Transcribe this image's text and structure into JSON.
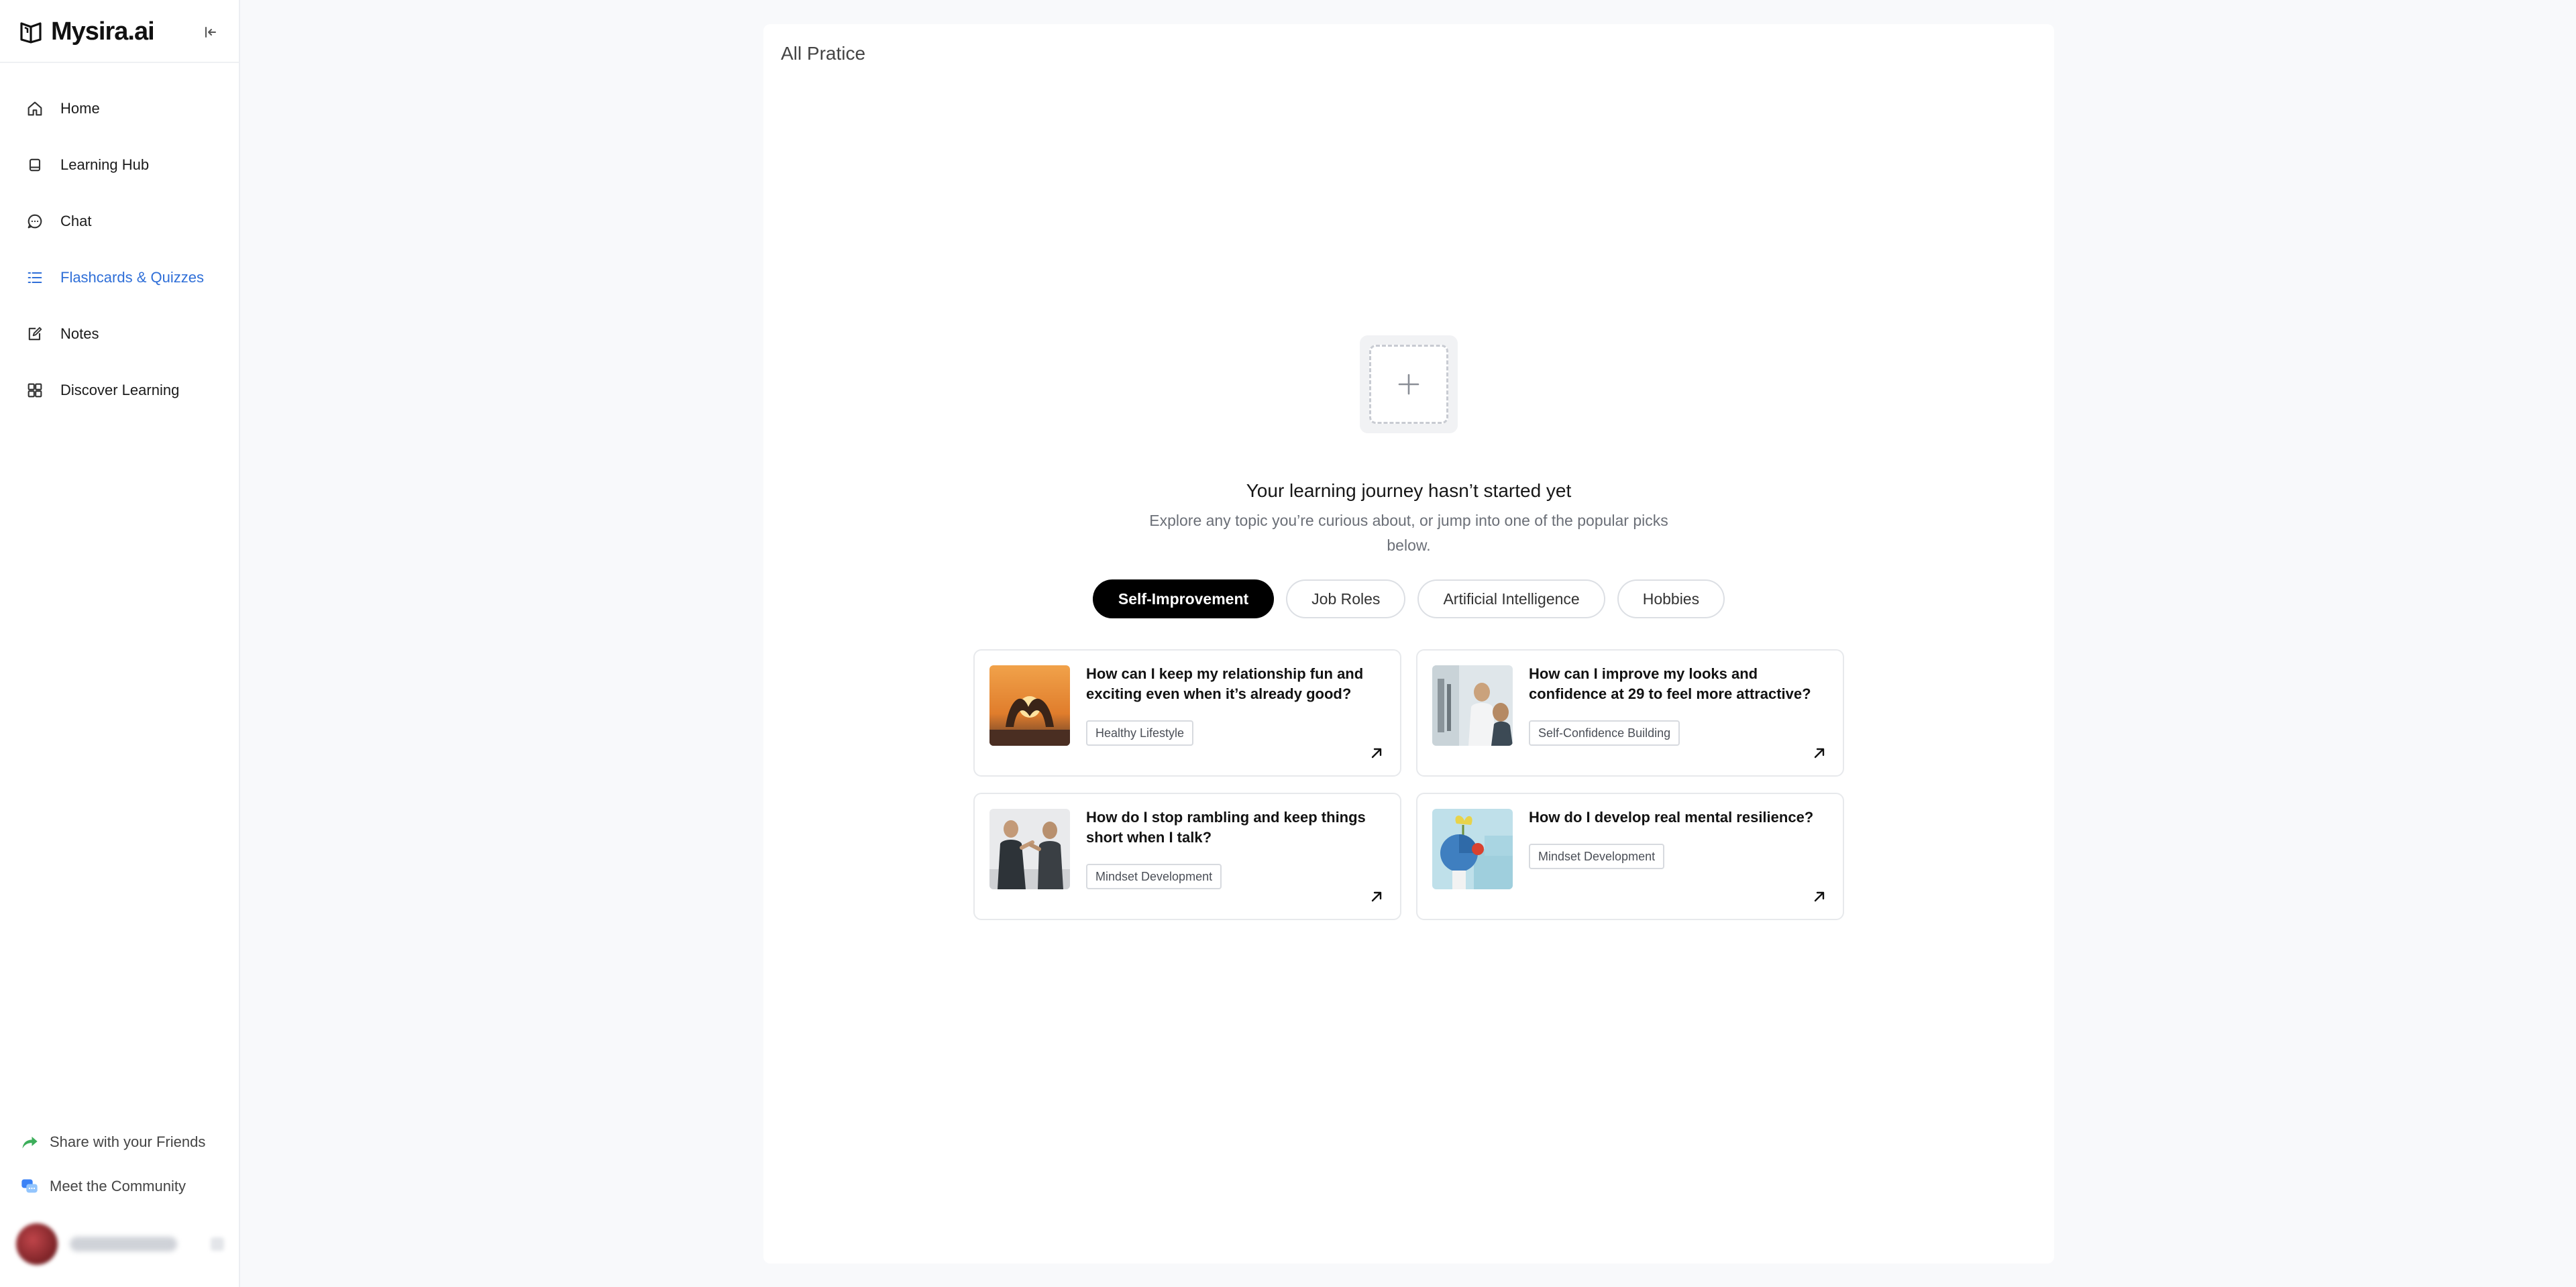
{
  "brand": {
    "name": "Mysira.ai"
  },
  "sidebar": {
    "items": [
      {
        "label": "Home",
        "icon": "home-icon"
      },
      {
        "label": "Learning Hub",
        "icon": "book-icon"
      },
      {
        "label": "Chat",
        "icon": "chat-icon"
      },
      {
        "label": "Flashcards & Quizzes",
        "icon": "list-icon",
        "active": true
      },
      {
        "label": "Notes",
        "icon": "note-icon"
      },
      {
        "label": "Discover Learning",
        "icon": "grid-icon"
      }
    ],
    "bottom": [
      {
        "label": "Share with your Friends",
        "icon": "share-icon"
      },
      {
        "label": "Meet the Community",
        "icon": "community-icon"
      }
    ]
  },
  "main": {
    "title": "All Pratice",
    "empty_title": "Your learning journey hasn’t started yet",
    "empty_subtitle": "Explore any topic you’re curious about, or jump into one of the popular picks below.",
    "chips": [
      {
        "label": "Self-Improvement",
        "active": true
      },
      {
        "label": "Job Roles"
      },
      {
        "label": "Artificial Intelligence"
      },
      {
        "label": "Hobbies"
      }
    ],
    "cards": [
      {
        "question": "How can I keep my relationship fun and exciting even when it’s already good?",
        "tag": "Healthy Lifestyle"
      },
      {
        "question": "How can I improve my looks and confidence at 29 to feel more attractive?",
        "tag": "Self-Confidence Building"
      },
      {
        "question": "How do I stop rambling and keep things short when I talk?",
        "tag": "Mindset Development"
      },
      {
        "question": "How do I develop real mental resilience?",
        "tag": "Mindset Development"
      }
    ]
  },
  "colors": {
    "accent": "#2f6fd8",
    "chip_active_bg": "#000000"
  }
}
